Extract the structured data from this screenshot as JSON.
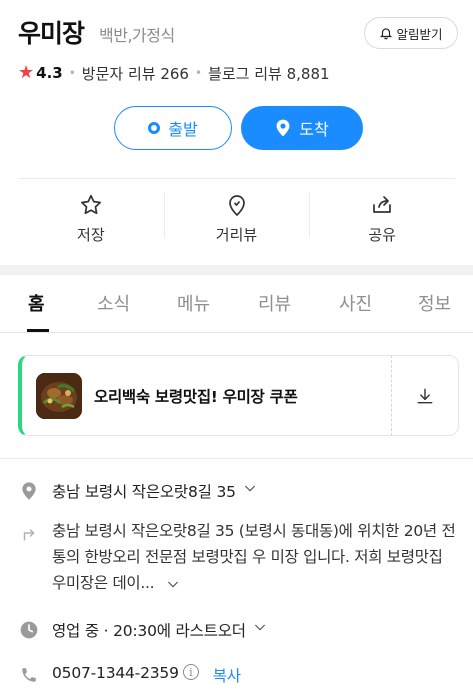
{
  "place": {
    "name": "우미장",
    "category": "백반,가정식",
    "notify_label": "알림받기",
    "rating": "4.3",
    "visitor_reviews": "방문자 리뷰 266",
    "blog_reviews": "블로그 리뷰 8,881"
  },
  "buttons": {
    "start_label": "출발",
    "arrive_label": "도착"
  },
  "actions": [
    {
      "label": "저장",
      "icon": "star-outline-icon"
    },
    {
      "label": "거리뷰",
      "icon": "map-pin-outline-icon"
    },
    {
      "label": "공유",
      "icon": "share-icon"
    }
  ],
  "tabs": [
    "홈",
    "소식",
    "메뉴",
    "리뷰",
    "사진",
    "정보"
  ],
  "active_tab": "홈",
  "coupon": {
    "text": "오리백숙 보령맛집! 우미장 쿠폰"
  },
  "info": {
    "address": "충남 보령시 작은오랏8길 35",
    "description": "충남 보령시 작은오랏8길 35 (보령시 동대동)에 위치한 20년 전통의 한방오리 전문점 보령맛집 우 미장 입니다. 저희 보령맛집 우미장은 데이...",
    "hours": "영업 중 · 20:30에 라스트오더",
    "phone": "0507-1344-2359",
    "copy_label": "복사"
  },
  "colors": {
    "accent": "#1a8cff",
    "star": "#f24147",
    "coupon_stripe": "#2bd77f"
  }
}
